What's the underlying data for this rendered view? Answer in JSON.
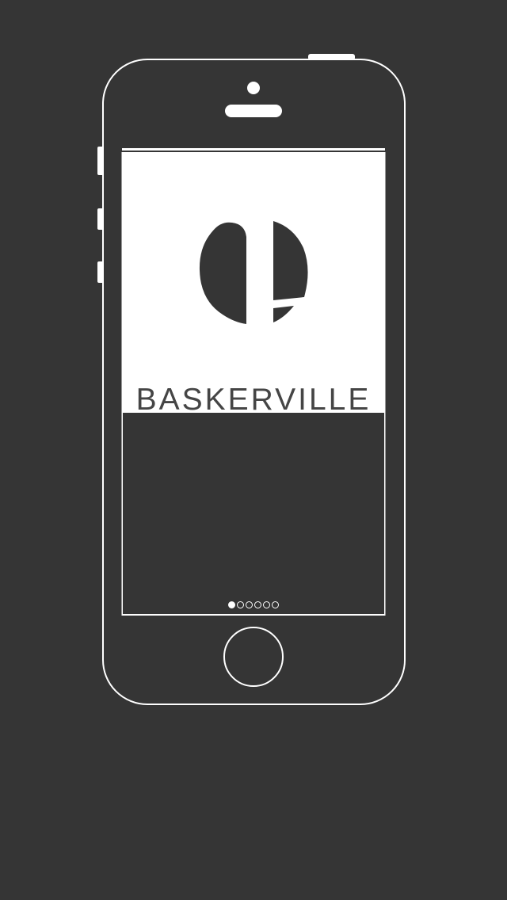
{
  "app": {
    "title": "BASKERVILLE",
    "logo": "baskerville-logo"
  },
  "pager": {
    "total": 6,
    "current": 1
  },
  "colors": {
    "background": "#353535",
    "frame_stroke": "#ffffff",
    "screen_light": "#ffffff",
    "logo": "#353535",
    "title_text": "#454545"
  }
}
